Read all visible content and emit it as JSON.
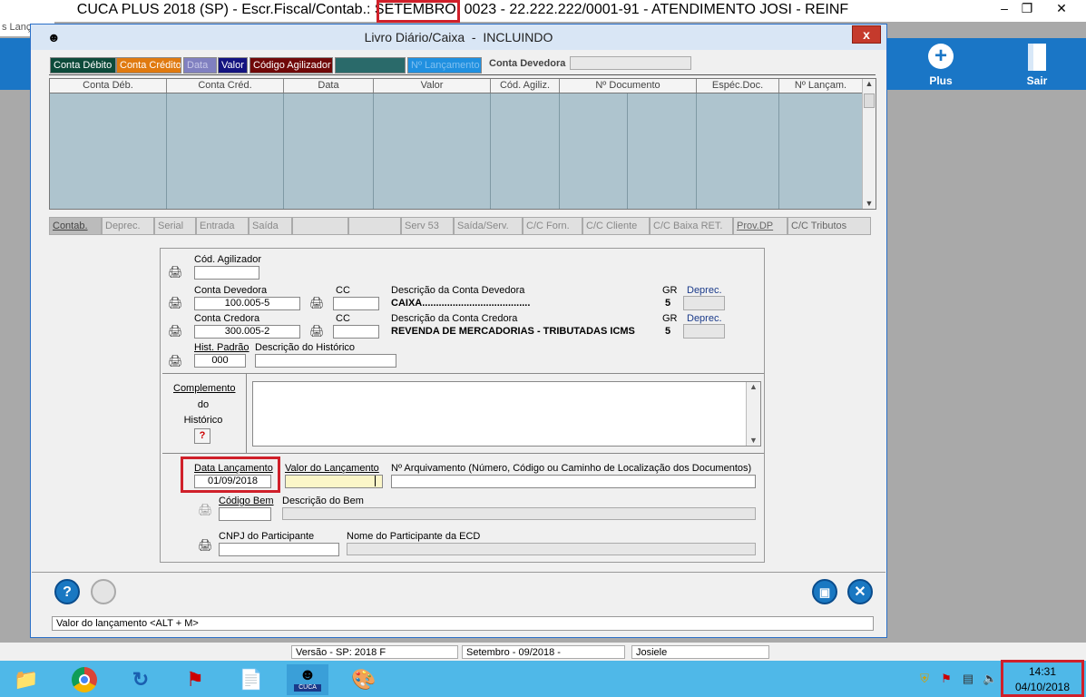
{
  "window": {
    "title": "CUCA PLUS 2018 (SP) - Escr.Fiscal/Contab.: SETEMBRO: 0023 - 22.222.222/0001-91 - ATENDIMENTO JOSI - REINF",
    "menu_fragment": "s  Lanç"
  },
  "app_band": {
    "plus_label": "Plus",
    "exit_label": "Sair"
  },
  "dialog": {
    "title": "Livro Diário/Caixa  -  INCLUINDO",
    "close": "x"
  },
  "tabs_top": [
    {
      "label": "Conta Débito",
      "bg": "#0d4a3a",
      "fg": "#ffffff"
    },
    {
      "label": "Conta Crédito",
      "bg": "#e07a10",
      "fg": "#ffffff"
    },
    {
      "label": "Data",
      "bg": "#8080c0",
      "fg": "#c8c8e8"
    },
    {
      "label": "Valor",
      "bg": "#141480",
      "fg": "#ffffff"
    },
    {
      "label": "Código Agilizador",
      "bg": "#700808",
      "fg": "#ffffff"
    },
    {
      "label": "",
      "bg": "#2a6a6a",
      "fg": "#ffffff"
    },
    {
      "label": "Nº Lançamento",
      "bg": "#2090e0",
      "fg": "#80c0f0"
    }
  ],
  "conta_devedora_label": "Conta Devedora",
  "grid": {
    "headers": [
      "Conta Déb.",
      "Conta Créd.",
      "Data",
      "Valor",
      "Cód. Agiliz.",
      "Nº Documento",
      "Espéc.Doc.",
      "Nº Lançam."
    ]
  },
  "tabs_bottom": [
    "Contab.",
    "Deprec.",
    "Serial",
    "Entrada",
    "Saída",
    "",
    "",
    "Serv 53",
    "Saída/Serv.",
    "C/C Forn.",
    "C/C Cliente",
    "C/C Baixa RET.",
    "Prov.DP",
    "C/C Tributos"
  ],
  "form": {
    "cod_agilizador_label": "Cód. Agilizador",
    "conta_devedora_label": "Conta Devedora",
    "conta_devedora_value": "100.005-5",
    "cc_label": "CC",
    "desc_devedora_label": "Descrição da Conta Devedora",
    "desc_devedora_value": "CAIXA.......................................",
    "gr_label": "GR",
    "gr_dev_value": "5",
    "deprec_label": "Deprec.",
    "conta_credora_label": "Conta Credora",
    "conta_credora_value": "300.005-2",
    "desc_credora_label": "Descrição da Conta Credora",
    "desc_credora_value": "REVENDA DE MERCADORIAS - TRIBUTADAS ICMS",
    "gr_cred_value": "5",
    "hist_padrao_label": "Hist. Padrão",
    "hist_padrao_value": "000",
    "desc_historico_label": "Descrição do Histórico",
    "complemento_l1": "Complemento",
    "complemento_l2": "do",
    "complemento_l3": "Histórico",
    "help_q": "?",
    "data_lanc_label": "Data Lançamento",
    "data_lanc_value": "01/09/2018",
    "valor_lanc_label": "Valor do Lançamento",
    "arquivamento_label": "Nº Arquivamento (Número, Código ou Caminho de Localização dos Documentos)",
    "cod_bem_label": "Código Bem",
    "desc_bem_label": "Descrição do Bem",
    "cnpj_label": "CNPJ do Participante",
    "nome_part_label": "Nome do Participante da ECD"
  },
  "bottom": {
    "help_icon": "?",
    "status_text": "Valor do lançamento  <ALT + M>"
  },
  "statusbar": [
    "Versão - SP: 2018 F",
    "Setembro - 09/2018 -",
    "Josiele"
  ],
  "taskbar": {
    "clock_time": "14:31",
    "clock_date": "04/10/2018",
    "cuca_label": "CUCA"
  }
}
